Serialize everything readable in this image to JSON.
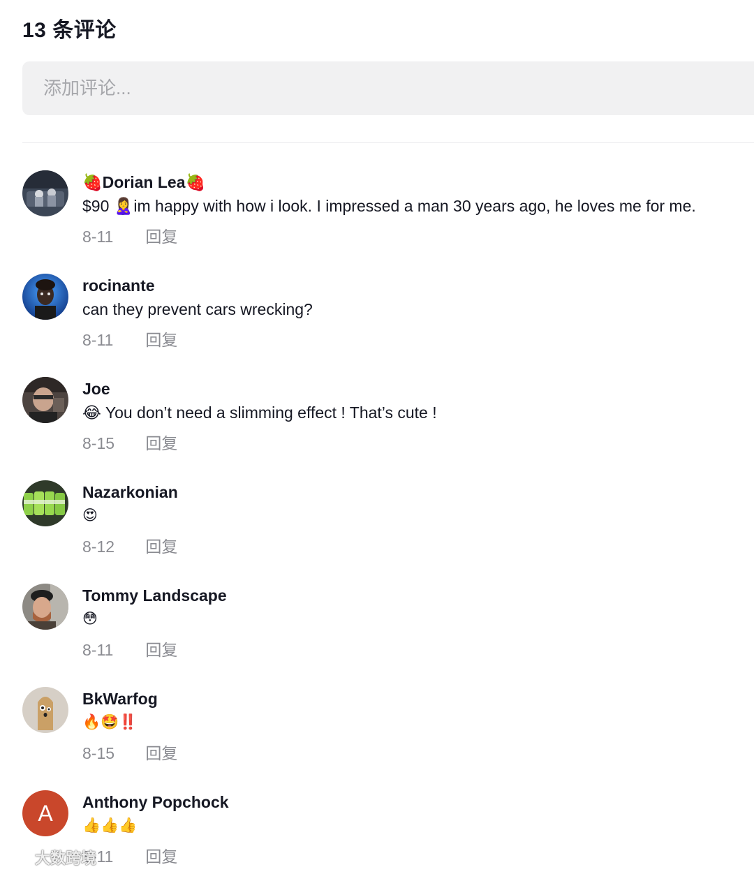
{
  "header": {
    "title": "13 条评论"
  },
  "input": {
    "placeholder": "添加评论..."
  },
  "comments": [
    {
      "name": "🍓Dorian Lea🍓",
      "text": "$90 🙎‍♀️im happy with how i look. I impressed a man 30 years ago, he loves me for me.",
      "date": "8-11",
      "reply": "回复",
      "avatar_icon": "photo-avatar"
    },
    {
      "name": "rocinante",
      "text": "can they prevent cars wrecking?",
      "date": "8-11",
      "reply": "回复",
      "avatar_icon": "photo-avatar"
    },
    {
      "name": "Joe",
      "text": "😂 You don’t need a slimming effect ! That’s cute !",
      "date": "8-15",
      "reply": "回复",
      "avatar_icon": "photo-avatar"
    },
    {
      "name": "Nazarkonian",
      "text": "😍",
      "date": "8-12",
      "reply": "回复",
      "avatar_icon": "photo-avatar"
    },
    {
      "name": "Tommy Landscape",
      "text": "😳",
      "date": "8-11",
      "reply": "回复",
      "avatar_icon": "photo-avatar"
    },
    {
      "name": "BkWarfog",
      "text": "🔥🤩‼️",
      "date": "8-15",
      "reply": "回复",
      "avatar_icon": "photo-avatar"
    },
    {
      "name": "Anthony Popchock",
      "text": "👍👍👍",
      "date": "8-11",
      "reply": "回复",
      "avatar_letter": "A",
      "avatar_color": "#c9472b"
    }
  ],
  "watermark": {
    "text": "大数跨境"
  },
  "colors": {
    "text_primary": "#161823",
    "text_secondary": "#8a8b91",
    "input_bg": "#f1f1f2",
    "divider": "#ececee"
  }
}
